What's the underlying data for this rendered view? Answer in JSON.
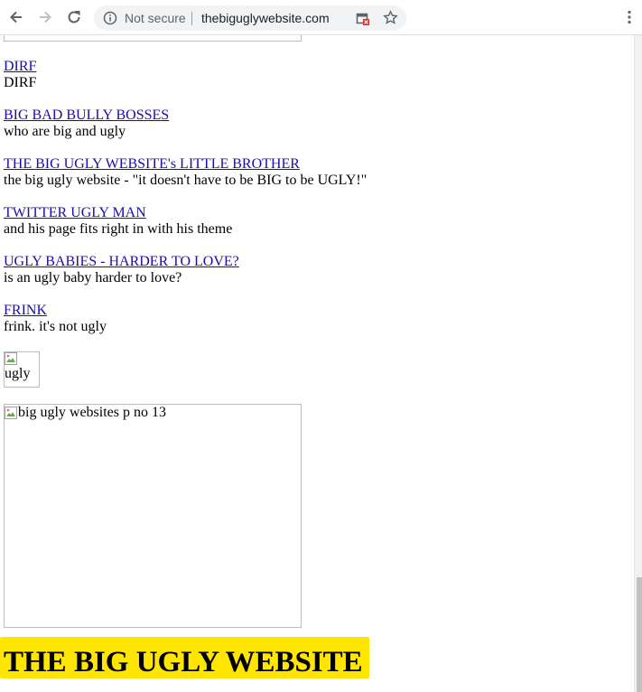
{
  "browser": {
    "security_label": "Not secure",
    "url": "thebiguglywebsite.com",
    "icons": {
      "back": "arrow-left-icon",
      "forward": "arrow-right-icon",
      "reload": "reload-icon",
      "info": "info-icon",
      "blocked": "blocked-popup-icon",
      "star": "star-icon",
      "menu": "kebab-menu-icon"
    }
  },
  "links": [
    {
      "title": "DIRF",
      "desc": "DIRF"
    },
    {
      "title": "BIG BAD BULLY BOSSES",
      "desc": "who are big and ugly"
    },
    {
      "title": "THE BIG UGLY WEBSITE's LITTLE BROTHER",
      "desc": "the big ugly website - \"it doesn't have to be BIG to be UGLY!\""
    },
    {
      "title": "TWITTER UGLY MAN",
      "desc": "and his page fits right in with his theme"
    },
    {
      "title": "UGLY BABIES - HARDER TO LOVE?",
      "desc": "is an ugly baby harder to love?"
    },
    {
      "title": "FRINK",
      "desc": "frink. it's not ugly"
    }
  ],
  "images": {
    "small_alt": "ugly",
    "big_alt": "big ugly websites p no 13"
  },
  "banner": {
    "title": "THE BIG UGLY WEBSITE",
    "color": "#ffe600"
  }
}
